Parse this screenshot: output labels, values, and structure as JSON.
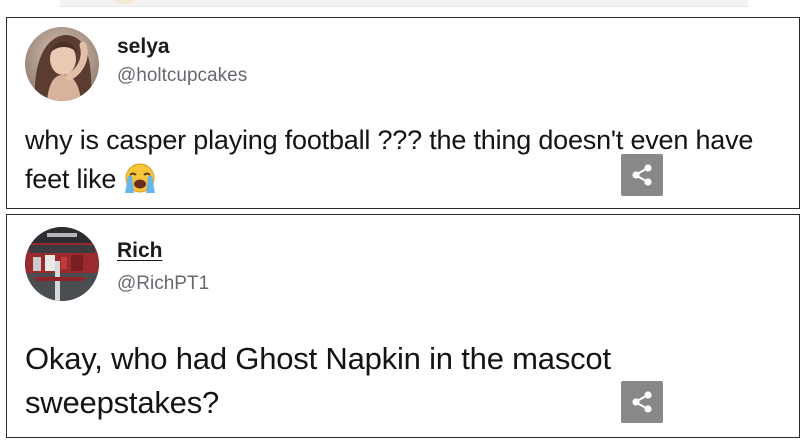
{
  "tweets": [
    {
      "display_name": "selya",
      "handle": "@holtcupcakes",
      "text": "why is casper playing football ??? the thing doesn't even have feet like",
      "emoji_icon": "loudly-crying-face-icon",
      "share_icon": "share-icon"
    },
    {
      "display_name": "Rich",
      "handle": "@RichPT1",
      "text": "Okay, who had Ghost Napkin in the mascot sweepstakes?",
      "share_icon": "share-icon"
    }
  ],
  "colors": {
    "card_border": "#2b2b2b",
    "handle": "#666a70",
    "share_button": "#888888",
    "text": "#141414"
  }
}
